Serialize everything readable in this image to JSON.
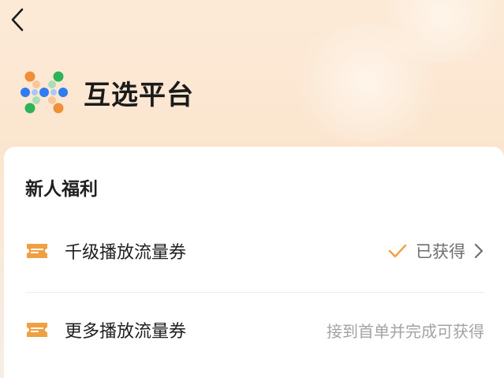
{
  "header": {
    "back_icon": "chevron-left-icon",
    "title": "互选平台",
    "logo_icon": "hub-dots-logo",
    "logo_colors": [
      "#f08f3a",
      "#2eb35a",
      "#2f7bf0"
    ]
  },
  "welfare": {
    "title": "新人福利",
    "items": [
      {
        "icon": "ticket-icon",
        "label": "千级播放流量券",
        "status": "已获得",
        "status_icon": "check-icon",
        "action_icon": "chevron-right-icon"
      },
      {
        "icon": "ticket-icon",
        "label": "更多播放流量券",
        "hint": "接到首单并完成可获得"
      }
    ]
  },
  "colors": {
    "accent_orange": "#f0a040",
    "background": "#fbe5cf"
  }
}
